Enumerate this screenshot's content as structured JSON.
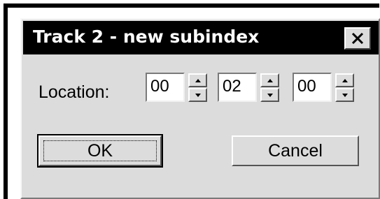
{
  "dialog": {
    "title": "Track 2 - new subindex",
    "close_icon": "close-x-icon"
  },
  "location": {
    "label": "Location:",
    "fields": [
      {
        "name": "minutes",
        "value": "00"
      },
      {
        "name": "seconds",
        "value": "02"
      },
      {
        "name": "frames",
        "value": "00"
      }
    ],
    "spin_up_icon": "triangle-up-icon",
    "spin_down_icon": "triangle-down-icon"
  },
  "buttons": {
    "ok_label": "OK",
    "cancel_label": "Cancel"
  },
  "colors": {
    "titlebar": "#000000",
    "face": "#dcdcdc",
    "field": "#ffffff"
  }
}
